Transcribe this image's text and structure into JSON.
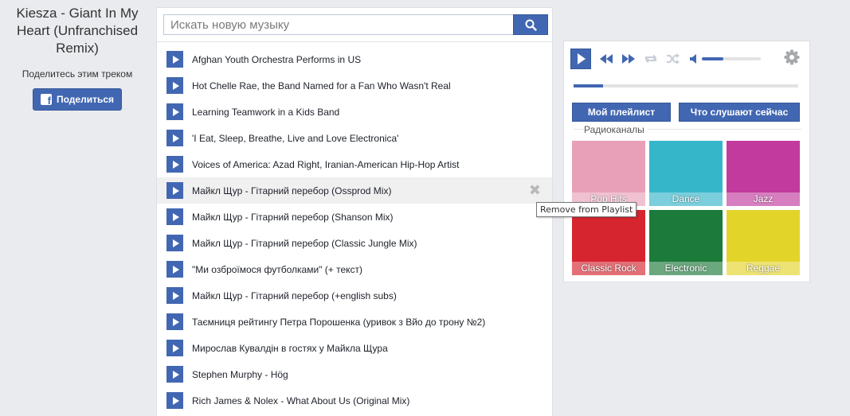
{
  "now_playing": {
    "title": "Kiesza - Giant In My Heart (Unfranchised Remix)",
    "share_caption": "Поделитесь этим треком",
    "share_button": "Поделиться"
  },
  "search": {
    "placeholder": "Искать новую музыку"
  },
  "tracks": [
    "Afghan Youth Orchestra Performs in US",
    "Hot Chelle Rae, the Band Named for a Fan Who Wasn't Real",
    "Learning Teamwork in a Kids Band",
    "'I Eat, Sleep, Breathe, Live and Love Electronica'",
    "Voices of America: Azad Right, Iranian-American Hip-Hop Artist",
    "Майкл Щур - Гітарний перебор (Ossprod Mix)",
    "Майкл Щур - Гітарний перебор (Shanson Mix)",
    "Майкл Щур - Гітарний перебор (Classic Jungle Mix)",
    "\"Ми озброїмося футболками\" (+ текст)",
    "Майкл Щур - Гітарний перебор (+english subs)",
    "Таємниця рейтингу Петра Порошенка (уривок з Вйо до трону №2)",
    "Мирослав Кувалдін в гостях у Майкла Щура",
    "Stephen Murphy - Hög",
    "Rich James & Nolex - What About Us (Original Mix)"
  ],
  "tooltip": "Remove from Playlist",
  "player": {
    "volume_fraction": 0.36,
    "progress_fraction": 0.13,
    "my_playlist_button": "Мой плейлист",
    "listening_now_button": "Что слушают сейчас",
    "radio_section_label": "Радиоканалы",
    "radio_channels": [
      {
        "label": "Pop Hits",
        "bg": "#e8a0b8"
      },
      {
        "label": "Dance",
        "bg": "#35b6c9"
      },
      {
        "label": "Jazz",
        "bg": "#c23a9e"
      },
      {
        "label": "Classic Rock",
        "bg": "#d6252f"
      },
      {
        "label": "Electronic",
        "bg": "#1c7a3a"
      },
      {
        "label": "Reggae",
        "bg": "#e3d42a"
      }
    ]
  },
  "colors": {
    "accent": "#4267b2",
    "page_bg": "#e9ebee"
  }
}
